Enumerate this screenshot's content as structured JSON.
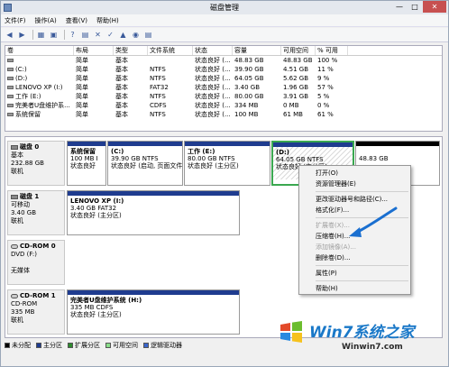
{
  "window": {
    "title": "磁盘管理"
  },
  "menubar": {
    "items": [
      "文件(F)",
      "操作(A)",
      "查看(V)",
      "帮助(H)"
    ]
  },
  "table": {
    "headers": [
      "卷",
      "布局",
      "类型",
      "文件系统",
      "状态",
      "容量",
      "可用空间",
      "% 可用"
    ],
    "rows": [
      [
        "",
        "简单",
        "基本",
        "",
        "状态良好 (...",
        "48.83 GB",
        "48.83 GB",
        "100 %"
      ],
      [
        "(C:)",
        "简单",
        "基本",
        "NTFS",
        "状态良好 (...",
        "39.90 GB",
        "4.51 GB",
        "11 %"
      ],
      [
        "(D:)",
        "简单",
        "基本",
        "NTFS",
        "状态良好 (...",
        "64.05 GB",
        "5.62 GB",
        "9 %"
      ],
      [
        "LENOVO XP (I:)",
        "简单",
        "基本",
        "FAT32",
        "状态良好 (...",
        "3.40 GB",
        "1.96 GB",
        "57 %"
      ],
      [
        "工作 (E:)",
        "简单",
        "基本",
        "NTFS",
        "状态良好 (...",
        "80.00 GB",
        "3.91 GB",
        "5 %"
      ],
      [
        "完美者U盘维护系...",
        "简单",
        "基本",
        "CDFS",
        "状态良好 (...",
        "334 MB",
        "0 MB",
        "0 %"
      ],
      [
        "系统保留",
        "简单",
        "基本",
        "NTFS",
        "状态良好 (...",
        "100 MB",
        "61 MB",
        "61 %"
      ]
    ]
  },
  "disks": {
    "d0": {
      "name": "磁盘 0",
      "type": "基本",
      "size": "232.88 GB",
      "status": "联机",
      "p1": {
        "name": "系统保留",
        "l1": "100 MB I",
        "l2": "状态良好"
      },
      "p2": {
        "name": "(C:)",
        "l1": "39.90 GB NTFS",
        "l2": "状态良好 (启动, 页面文件,"
      },
      "p3": {
        "name": "工作  (E:)",
        "l1": "80.00 GB NTFS",
        "l2": "状态良好 (主分区)"
      },
      "p4": {
        "name": "(D:)",
        "l1": "64.05 GB NTFS",
        "l2": "状态良好 (主分区)"
      },
      "p5": {
        "l1": "48.83 GB"
      }
    },
    "d1": {
      "name": "磁盘 1",
      "type": "可移动",
      "size": "3.40 GB",
      "status": "联机",
      "p1": {
        "name": "LENOVO XP  (I:)",
        "l1": "3.40 GB FAT32",
        "l2": "状态良好 (主分区)"
      }
    },
    "cd0": {
      "name": "CD-ROM 0",
      "type": "DVD (F:)",
      "size": "",
      "status": "无媒体"
    },
    "cd1": {
      "name": "CD-ROM 1",
      "type": "CD-ROM",
      "size": "335 MB",
      "status": "联机",
      "p1": {
        "name": "完美者U盘维护系统  (H:)",
        "l1": "335 MB CDFS",
        "l2": "状态良好 (主分区)"
      }
    }
  },
  "legend": {
    "items": [
      {
        "label": "未分配",
        "color": "#000000"
      },
      {
        "label": "主分区",
        "color": "#1f3c8f"
      },
      {
        "label": "扩展分区",
        "color": "#2e8b2e"
      },
      {
        "label": "可用空间",
        "color": "#8ade8a"
      },
      {
        "label": "逻辑驱动器",
        "color": "#3a66cc"
      }
    ]
  },
  "contextmenu": {
    "open": "打开(O)",
    "explore": "资源管理器(E)",
    "change_letter": "更改驱动器号和路径(C)...",
    "format": "格式化(F)...",
    "extend": "扩展卷(X)...",
    "shrink": "压缩卷(H)...",
    "mirror": "添加镜像(A)...",
    "delete": "删除卷(D)...",
    "properties": "属性(P)",
    "help": "帮助(H)"
  },
  "watermark": {
    "title": "Win7系统之家",
    "url": "Winwin7.com"
  }
}
